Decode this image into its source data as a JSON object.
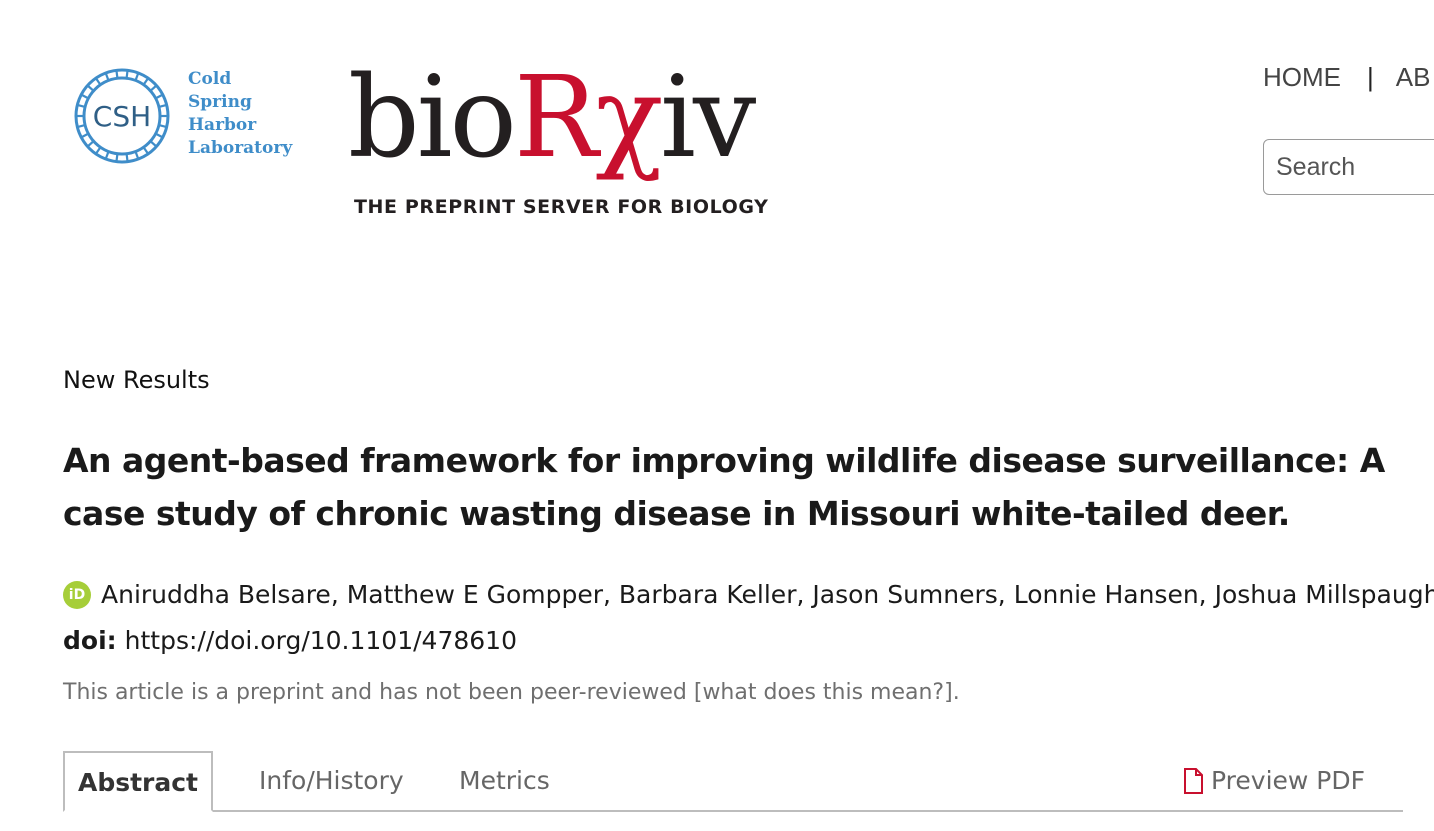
{
  "header": {
    "cshl_logo": {
      "monogram": "CSH",
      "lines": [
        "Cold",
        "Spring",
        "Harbor",
        "Laboratory"
      ],
      "color": "#3f8dc9"
    },
    "biorxiv_logo": {
      "word_prefix": "bio",
      "word_accent": "Rχ",
      "word_suffix": "iv",
      "tagline": "THE PREPRINT SERVER FOR BIOLOGY",
      "accent_color": "#c8102e"
    },
    "nav": {
      "home": "HOME",
      "separator": "|",
      "next_partial": "AB"
    },
    "search": {
      "placeholder": "Search"
    }
  },
  "article": {
    "type": "New Results",
    "title": "An agent-based framework for improving wildlife disease surveillance: A case study of chronic wasting disease in Missouri white-tailed deer.",
    "orcid_icon_text": "iD",
    "authors": [
      "Aniruddha Belsare",
      "Matthew E Gompper",
      "Barbara Keller",
      "Jason Sumners",
      "Lonnie Hansen",
      "Joshua Millspaugh"
    ],
    "doi_label": "doi:",
    "doi_url": "https://doi.org/10.1101/478610",
    "peer_note_prefix": "This article is a preprint and has not been peer-reviewed ",
    "peer_note_link": "[what does this mean?]",
    "peer_note_suffix": "."
  },
  "tabs": {
    "abstract": "Abstract",
    "info_history": "Info/History",
    "metrics": "Metrics",
    "preview_pdf": "Preview PDF",
    "pdf_icon_color": "#c8102e"
  }
}
